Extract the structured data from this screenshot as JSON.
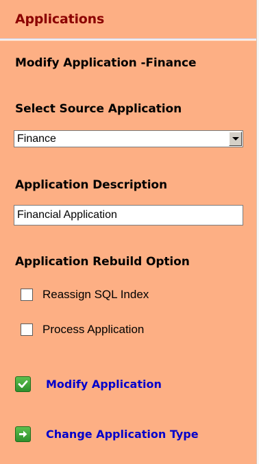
{
  "header": {
    "title": "Applications"
  },
  "form": {
    "title": "Modify Application -Finance",
    "source_label": "Select Source Application",
    "source_value": "Finance",
    "description_label": "Application Description",
    "description_value": "Financial Application",
    "rebuild_label": "Application Rebuild Option",
    "options": [
      {
        "label": "Reassign SQL Index",
        "checked": false
      },
      {
        "label": "Process Application",
        "checked": false
      }
    ]
  },
  "actions": [
    {
      "label": "Modify Application",
      "icon": "checkmark-icon"
    },
    {
      "label": "Change Application Type",
      "icon": "arrow-right-icon"
    }
  ],
  "colors": {
    "panel_background": "#fdaf84",
    "header_text": "#8b0000",
    "action_link": "#0000cc",
    "icon_green": "#3a9a34"
  }
}
